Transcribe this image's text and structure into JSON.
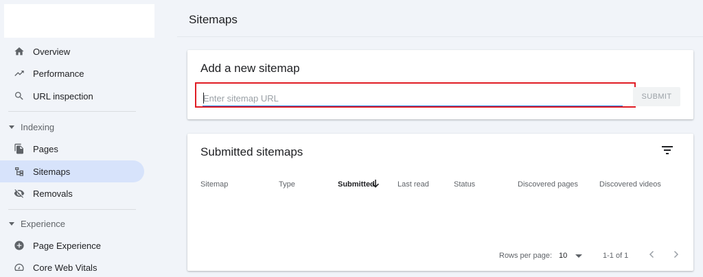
{
  "sidebar": {
    "items": [
      {
        "label": "Overview",
        "icon": "home-icon"
      },
      {
        "label": "Performance",
        "icon": "trending-up-icon"
      },
      {
        "label": "URL inspection",
        "icon": "search-icon"
      }
    ],
    "sections": [
      {
        "label": "Indexing",
        "items": [
          {
            "label": "Pages",
            "icon": "pages-icon"
          },
          {
            "label": "Sitemaps",
            "icon": "sitemap-icon",
            "active": true
          },
          {
            "label": "Removals",
            "icon": "eye-off-icon"
          }
        ]
      },
      {
        "label": "Experience",
        "items": [
          {
            "label": "Page Experience",
            "icon": "plus-circle-icon"
          },
          {
            "label": "Core Web Vitals",
            "icon": "gauge-icon"
          }
        ]
      }
    ]
  },
  "main": {
    "title": "Sitemaps",
    "add_card": {
      "title": "Add a new sitemap",
      "input_placeholder": "Enter sitemap URL",
      "input_value": "",
      "submit_label": "SUBMIT"
    },
    "submitted_card": {
      "title": "Submitted sitemaps",
      "columns": [
        "Sitemap",
        "Type",
        "Submitted",
        "Last read",
        "Status",
        "Discovered pages",
        "Discovered videos"
      ],
      "sorted_column": "Submitted",
      "rows": [],
      "footer": {
        "rows_per_page_label": "Rows per page:",
        "rows_per_page_value": "10",
        "range_label": "1-1 of 1"
      }
    }
  },
  "colors": {
    "accent": "#1a73e8",
    "highlight": "#e01c24",
    "active_nav": "#d7e3fb",
    "background": "#f1f4f9"
  }
}
